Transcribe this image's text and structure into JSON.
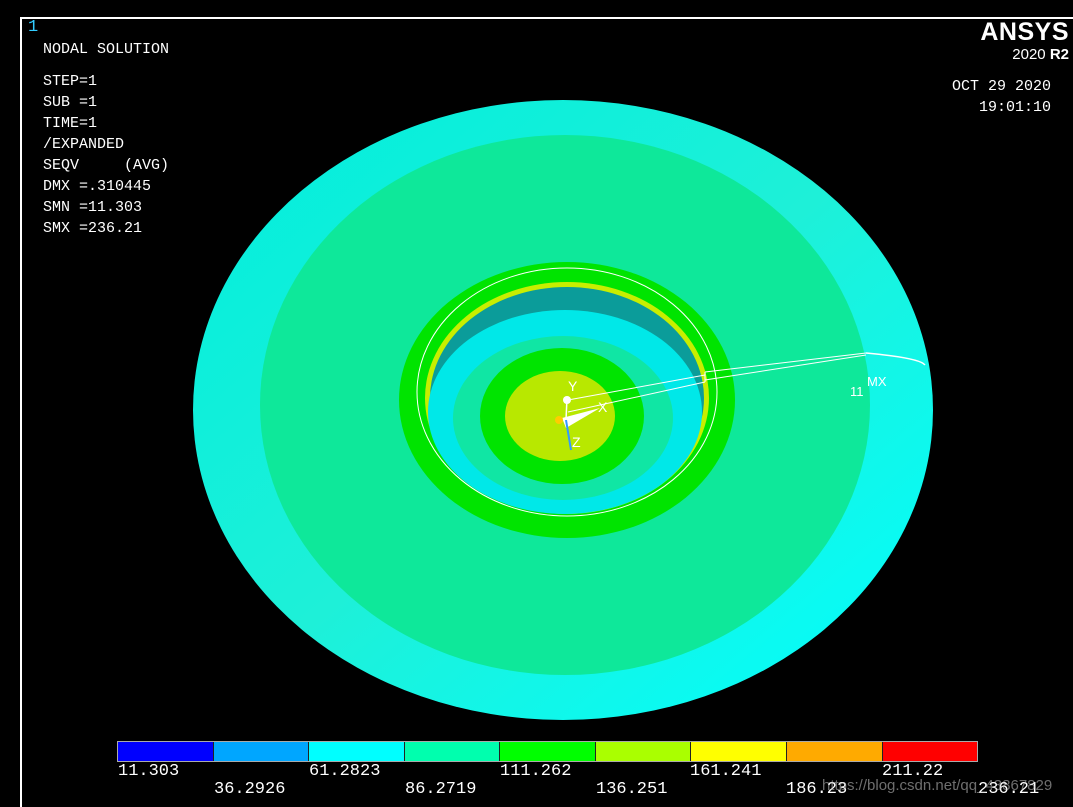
{
  "window_number": "1",
  "info_lines": [
    "NODAL SOLUTION",
    "STEP=1",
    "SUB =1",
    "TIME=1",
    "/EXPANDED",
    "SEQV     (AVG)",
    "DMX =.310445",
    "SMN =11.303",
    "SMX =236.21"
  ],
  "logo": {
    "brand": "ANSYS",
    "version": "2020",
    "release": "R2"
  },
  "date": "OCT 29 2020",
  "time": "19:01:10",
  "triad": {
    "x": "X",
    "y": "Y",
    "z": "Z"
  },
  "markers": {
    "node": "11",
    "mx": "MX"
  },
  "legend": {
    "colors": [
      "#0000ff",
      "#00a6ff",
      "#00ffff",
      "#00ffae",
      "#00ff00",
      "#aaff00",
      "#ffff00",
      "#ffaa00",
      "#ff0000"
    ],
    "top_labels": [
      "11.303",
      "61.2823",
      "111.262",
      "161.241",
      "211.22"
    ],
    "bottom_labels": [
      "36.2926",
      "86.2719",
      "136.251",
      "186.23",
      "236.21"
    ]
  },
  "watermark": "https://blog.csdn.net/qq_43867829"
}
